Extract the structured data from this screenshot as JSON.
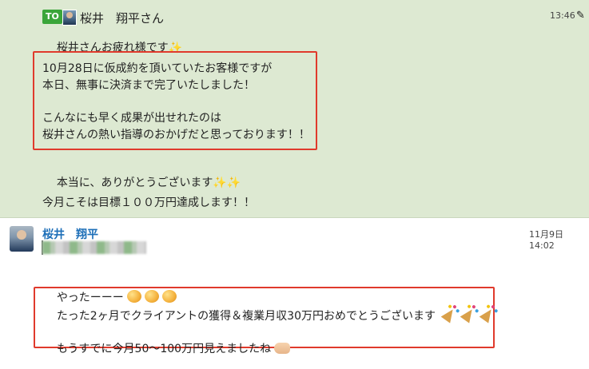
{
  "message1": {
    "to_badge": "TO",
    "to_name": "桜井　翔平さん",
    "time": "13:46",
    "lines": [
      "桜井さんお疲れ様です",
      "10月28日に仮成約を頂いていたお客様ですが",
      "本日、無事に決済まで完了いたしました！",
      "こんなにも早く成果が出せれたのは",
      "桜井さんの熱い指導のおかげだと思っております！！",
      "本当に、ありがとうございます",
      "今月こそは目標１００万円達成します！！"
    ]
  },
  "message2": {
    "sender": "桜井　翔平",
    "time": "11月9日 14:02",
    "lines": [
      "やったーーー",
      "たった2ヶ月でクライアントの獲得＆複業月収30万円おめでとうございます",
      "もうすでに今月50〜100万円見えましたね"
    ]
  },
  "icons": {
    "sparkle": "sparkles-icon",
    "edit": "pencil-icon",
    "face": "grinning-face-icon",
    "popper": "party-popper-icon",
    "hand": "clapping-hand-icon"
  },
  "colors": {
    "message1_bg": "#dde9d2",
    "highlight_box": "#e03a2c",
    "to_badge": "#3aa53a",
    "sender_name": "#1d6fb8"
  }
}
